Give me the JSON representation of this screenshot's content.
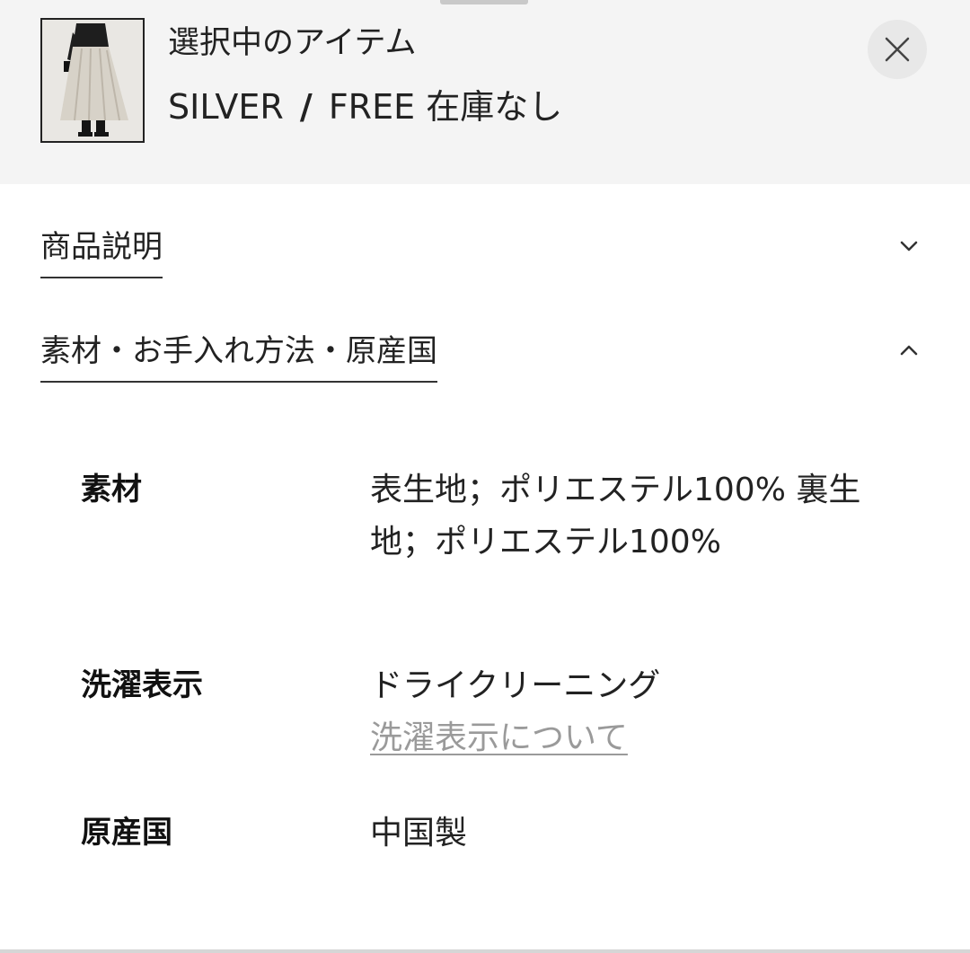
{
  "selected_item": {
    "title": "選択中のアイテム",
    "color": "SILVER",
    "separator": "/",
    "size": "FREE",
    "stock_status": "在庫なし",
    "close_icon": "close-icon",
    "thumbnail_icon": "product-thumbnail"
  },
  "sections": [
    {
      "label": "商品説明",
      "state": "collapsed",
      "icon": "chevron-down-icon"
    },
    {
      "label": "素材・お手入れ方法・原産国",
      "state": "expanded",
      "icon": "chevron-up-icon"
    }
  ],
  "details": {
    "material": {
      "label": "素材",
      "value": "表生地；ポリエステル100% 裏生地；ポリエステル100%"
    },
    "washing": {
      "label": "洗濯表示",
      "value": "ドライクリーニング",
      "link": "洗濯表示について"
    },
    "origin": {
      "label": "原産国",
      "value": "中国製"
    }
  },
  "colors": {
    "header_background": "#f4f4f4",
    "text": "#222222",
    "link": "#9a9a9a"
  }
}
